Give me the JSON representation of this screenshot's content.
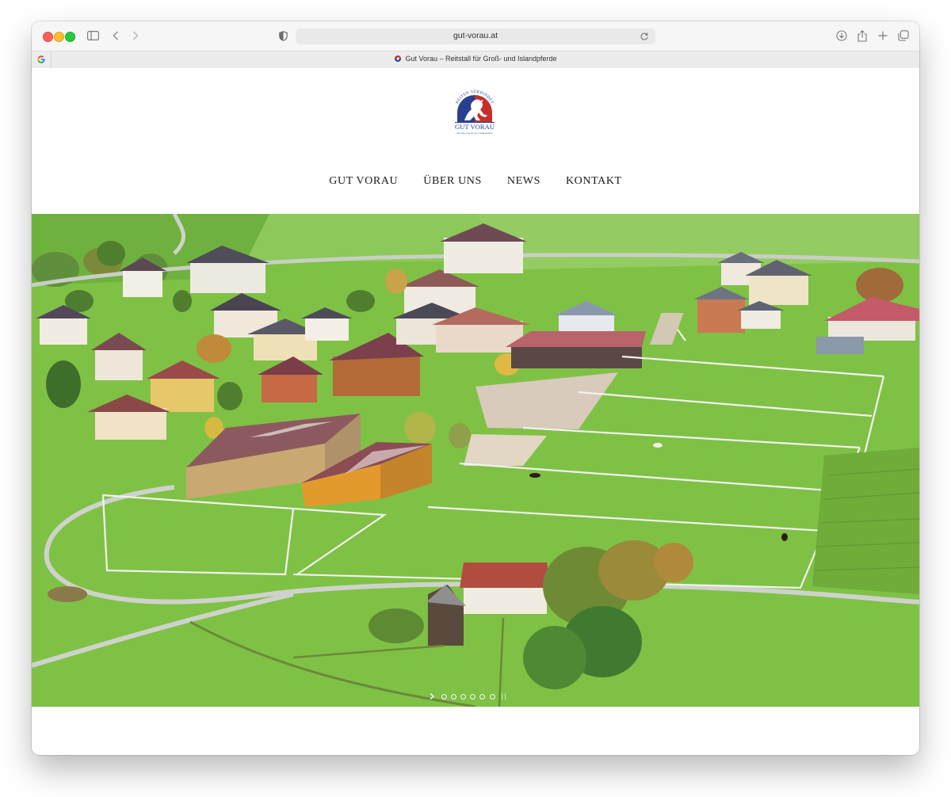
{
  "browser": {
    "url": "gut-vorau.at",
    "tab_title": "Gut Vorau – Reitstall für Groß- und Islandpferde",
    "icons": [
      "sidebar-icon",
      "back-icon",
      "forward-icon",
      "shield-icon",
      "reload-icon",
      "download-icon",
      "share-icon",
      "new-tab-icon",
      "tab-overview-icon",
      "google-icon"
    ]
  },
  "site": {
    "logo": {
      "arc_text": "REITEN VERBINDET",
      "name": "GUT VORAU",
      "tagline": "REITSTALL FÜR GROSS- & ISLANDPFERDE",
      "colors": {
        "red": "#c4312a",
        "blue": "#2a3f8f"
      }
    },
    "nav": [
      {
        "label": "GUT VORAU"
      },
      {
        "label": "ÜBER UNS"
      },
      {
        "label": "NEWS"
      },
      {
        "label": "KONTAKT"
      }
    ],
    "slider": {
      "total_slides": 6,
      "active_index": 0
    }
  }
}
